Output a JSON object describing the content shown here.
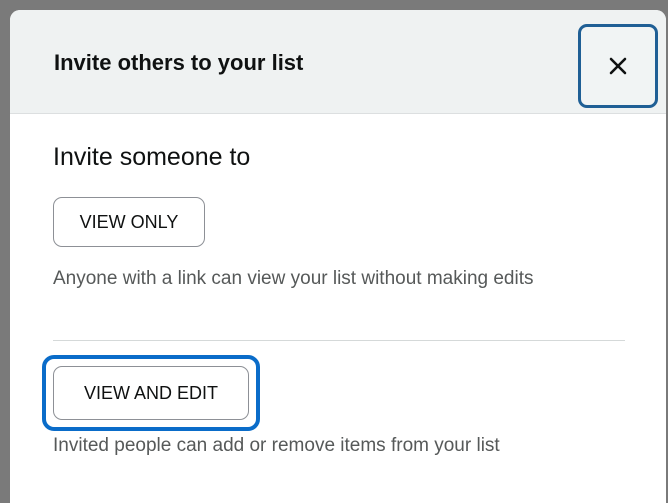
{
  "dialog": {
    "title": "Invite others to your list",
    "close_icon": "close-icon",
    "close_symbol": "×"
  },
  "invite": {
    "heading": "Invite someone to",
    "view_only": {
      "label": "VIEW ONLY",
      "description": "Anyone with a link can view your list without making edits"
    },
    "view_and_edit": {
      "label": "VIEW AND EDIT",
      "description": "Invited people can add or remove items from your list",
      "focused": true
    }
  },
  "colors": {
    "header_bg": "#eff2f2",
    "focus_ring": "#0a6cc9",
    "close_border": "#1f5f95",
    "text_primary": "#0f1111",
    "text_secondary": "#565959"
  }
}
